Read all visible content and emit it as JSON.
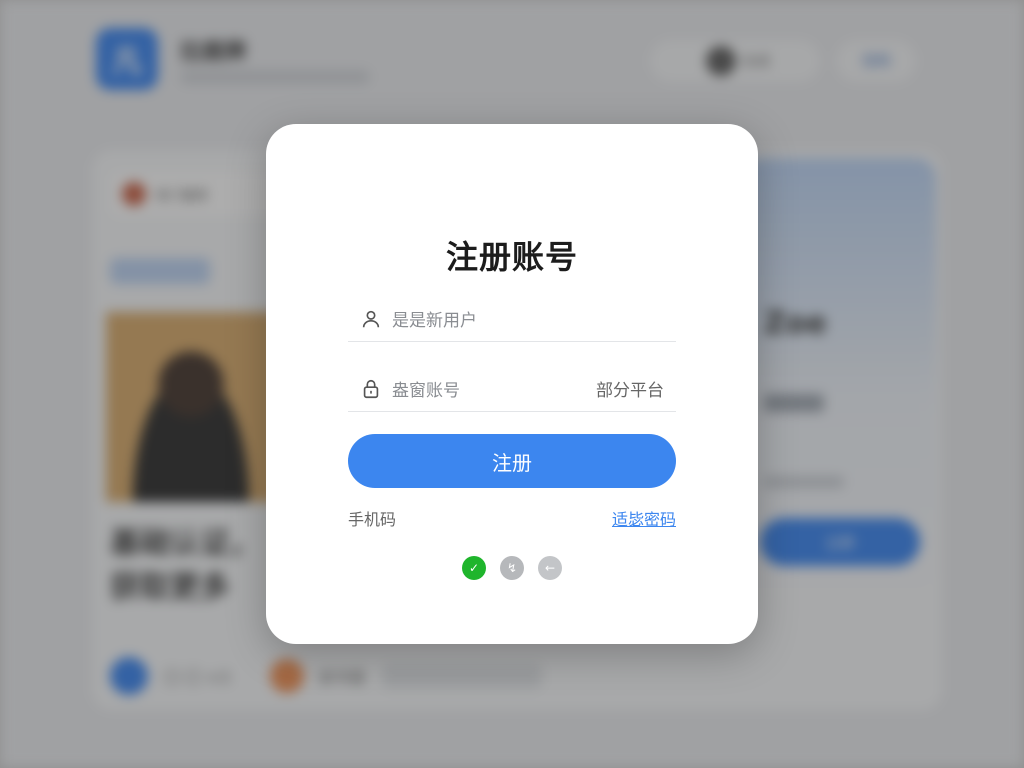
{
  "background": {
    "logo_text": "凡",
    "app_name": "拉鹿牌",
    "header_pill_label": "合成",
    "header_button_label": "官网",
    "tag_label": "热门推荐",
    "big_text": "基础认证，获取更多",
    "footer_item_1": "〇 〇 ×3",
    "footer_item_2": "读书荟",
    "right_card_title": "Zoe",
    "right_card_button": "立即"
  },
  "modal": {
    "title": "注册账号",
    "username_placeholder": "是是新用户",
    "password_placeholder": "盎窗账号",
    "password_suffix": "部分平台",
    "submit_label": "注册",
    "link_left": "手机码",
    "link_right": "适毖密码",
    "socials": [
      {
        "name": "wechat-icon",
        "glyph": "✓"
      },
      {
        "name": "weibo-icon",
        "glyph": "↯"
      },
      {
        "name": "back-icon",
        "glyph": "←"
      }
    ]
  },
  "colors": {
    "accent": "#3c86ef",
    "wechat": "#1fb52c",
    "overlay": "#8f8f8f"
  }
}
